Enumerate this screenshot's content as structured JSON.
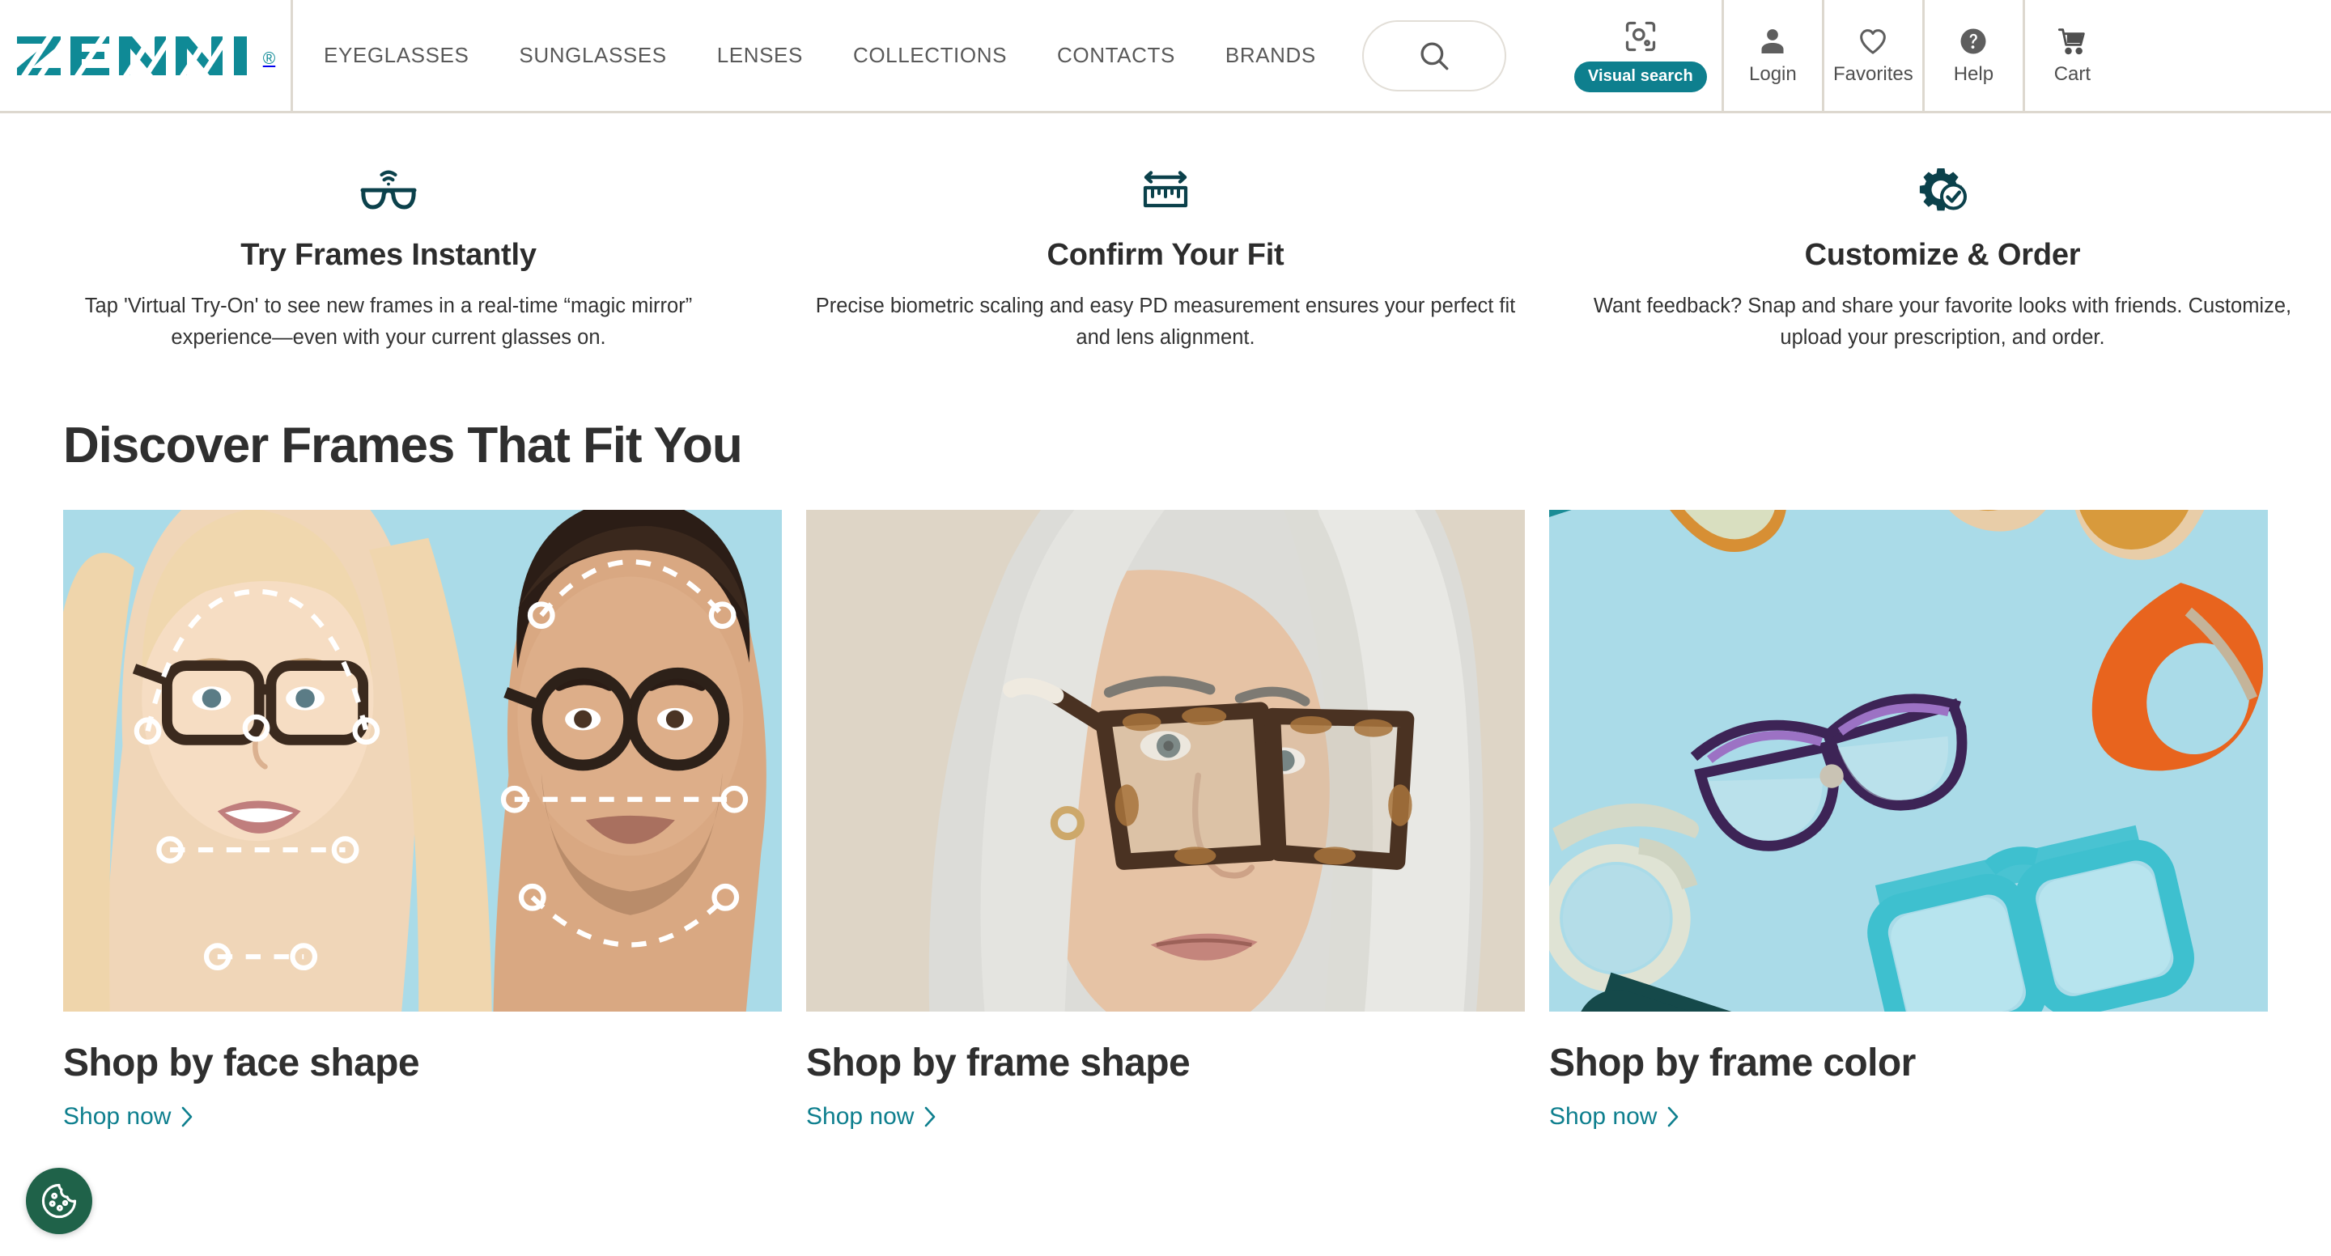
{
  "brand": {
    "name": "ZENNI",
    "registered_mark": "®",
    "accent_color": "#0f8a96",
    "logo_color": "#0f8a96"
  },
  "header": {
    "nav": [
      {
        "label": "EYEGLASSES",
        "name": "nav-eyeglasses"
      },
      {
        "label": "SUNGLASSES",
        "name": "nav-sunglasses"
      },
      {
        "label": "LENSES",
        "name": "nav-lenses"
      },
      {
        "label": "COLLECTIONS",
        "name": "nav-collections"
      },
      {
        "label": "CONTACTS",
        "name": "nav-contacts"
      },
      {
        "label": "BRANDS",
        "name": "nav-brands"
      }
    ],
    "search": {
      "icon": "search-icon",
      "placeholder": ""
    },
    "visual_search": {
      "icon": "visual-search-icon",
      "badge_label": "Visual search",
      "badge_color": "#0e7f8e"
    },
    "account": [
      {
        "label": "Login",
        "icon": "user-icon"
      },
      {
        "label": "Favorites",
        "icon": "heart-icon"
      },
      {
        "label": "Help",
        "icon": "question-circle-icon"
      },
      {
        "label": "Cart",
        "icon": "cart-icon"
      }
    ],
    "divider_color": "#ddd8cf"
  },
  "benefits": [
    {
      "icon": "glasses-wifi-icon",
      "title": "Try Frames Instantly",
      "description": "Tap 'Virtual Try-On' to see new frames in a real-time “magic mirror” experience—even with your current glasses on."
    },
    {
      "icon": "ruler-measure-icon",
      "title": "Confirm Your Fit",
      "description": "Precise biometric scaling and easy PD measurement ensures your perfect fit and lens alignment."
    },
    {
      "icon": "gear-check-icon",
      "title": "Customize & Order",
      "description": "Want feedback? Snap and share your favorite looks with friends. Customize, upload your prescription, and order."
    }
  ],
  "discover": {
    "heading": "Discover Frames That Fit You",
    "cards": [
      {
        "title": "Shop by face shape",
        "link_label": "Shop now",
        "image_alt": "Two people wearing glasses with dashed facial measurement overlay on light blue background",
        "background_color": "#aadbe8"
      },
      {
        "title": "Shop by frame shape",
        "link_label": "Shop now",
        "image_alt": "Woman with long silver hair wearing tortoiseshell frames on beige background",
        "background_color": "#ded5c6"
      },
      {
        "title": "Shop by frame color",
        "link_label": "Shop now",
        "image_alt": "Assorted colorful eyeglass frames scattered on light blue background",
        "background_color": "#aadbe8"
      }
    ],
    "link_color": "#0e7f8e",
    "chevron": "›"
  },
  "cookie_button": {
    "icon": "cookie-icon",
    "label": "",
    "color": "#1f6249"
  }
}
